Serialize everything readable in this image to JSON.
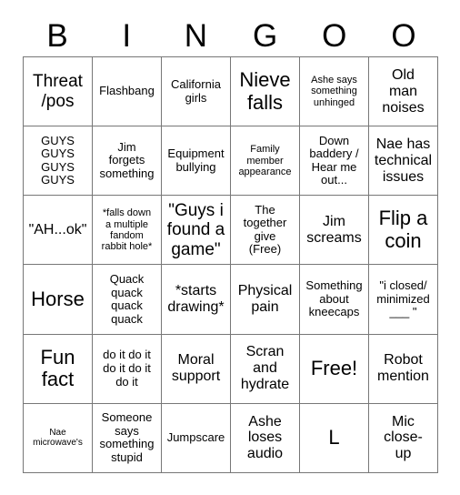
{
  "card": {
    "title": "Bingo Card",
    "header_letters": [
      "B",
      "I",
      "N",
      "G",
      "O",
      "O"
    ],
    "columns": 6,
    "rows": 6,
    "border_color": "#777777",
    "text_color": "#000000",
    "background_color": "#ffffff",
    "cells": [
      {
        "text": "Threat\n/pos",
        "size": "lg"
      },
      {
        "text": "Flashbang",
        "size": "sm"
      },
      {
        "text": "California\ngirls",
        "size": "sm"
      },
      {
        "text": "Nieve\nfalls",
        "size": "xl"
      },
      {
        "text": "Ashe says\nsomething\nunhinged",
        "size": "xs"
      },
      {
        "text": "Old\nman\nnoises",
        "size": "md"
      },
      {
        "text": "GUYS\nGUYS\nGUYS\nGUYS",
        "size": "sm"
      },
      {
        "text": "Jim\nforgets\nsomething",
        "size": "sm"
      },
      {
        "text": "Equipment\nbullying",
        "size": "sm"
      },
      {
        "text": "Family\nmember\nappearance",
        "size": "xs"
      },
      {
        "text": "Down\nbaddery /\nHear me\nout...",
        "size": "sm"
      },
      {
        "text": "Nae has\ntechnical\nissues",
        "size": "md"
      },
      {
        "text": "\"AH...ok\"",
        "size": "md"
      },
      {
        "text": "*falls down\na multiple\nfandom\nrabbit hole*",
        "size": "xs"
      },
      {
        "text": "\"Guys i\nfound a\ngame\"",
        "size": "lg"
      },
      {
        "text": "The\ntogether\ngive\n(Free)",
        "size": "sm"
      },
      {
        "text": "Jim\nscreams",
        "size": "md"
      },
      {
        "text": "Flip a\ncoin",
        "size": "xl"
      },
      {
        "text": "Horse",
        "size": "xl"
      },
      {
        "text": "Quack\nquack\nquack\nquack",
        "size": "sm"
      },
      {
        "text": "*starts\ndrawing*",
        "size": "md"
      },
      {
        "text": "Physical\npain",
        "size": "md"
      },
      {
        "text": "Something\nabout\nkneecaps",
        "size": "sm"
      },
      {
        "text": "\"i closed/\nminimized\n___ \"",
        "size": "sm"
      },
      {
        "text": "Fun\nfact",
        "size": "xl"
      },
      {
        "text": "do it do it\ndo it do it\ndo it",
        "size": "sm"
      },
      {
        "text": "Moral\nsupport",
        "size": "md"
      },
      {
        "text": "Scran\nand\nhydrate",
        "size": "md"
      },
      {
        "text": "Free!",
        "size": "xl"
      },
      {
        "text": "Robot\nmention",
        "size": "md"
      },
      {
        "text": "Nae\nmicrowave's",
        "size": "xxs"
      },
      {
        "text": "Someone\nsays\nsomething\nstupid",
        "size": "sm"
      },
      {
        "text": "Jumpscare",
        "size": "sm"
      },
      {
        "text": "Ashe\nloses\naudio",
        "size": "md"
      },
      {
        "text": "L",
        "size": "xl"
      },
      {
        "text": "Mic\nclose-\nup",
        "size": "md"
      }
    ]
  }
}
